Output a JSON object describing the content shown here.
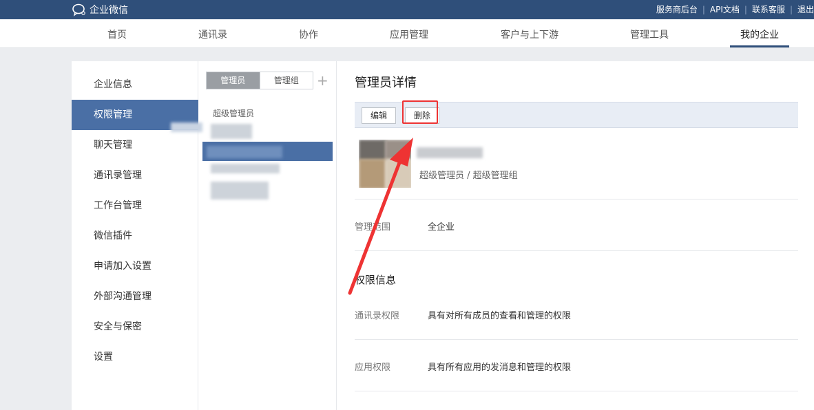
{
  "header": {
    "app_name": "企业微信",
    "links": [
      "服务商后台",
      "API文档",
      "联系客服",
      "退出"
    ]
  },
  "nav": {
    "items": [
      "首页",
      "通讯录",
      "协作",
      "应用管理",
      "客户与上下游",
      "管理工具",
      "我的企业"
    ],
    "active_index": 6
  },
  "sidebar": {
    "items": [
      "企业信息",
      "权限管理",
      "聊天管理",
      "通讯录管理",
      "工作台管理",
      "微信插件",
      "申请加入设置",
      "外部沟通管理",
      "安全与保密",
      "设置"
    ],
    "active_index": 1
  },
  "middle": {
    "tabs": [
      "管理员",
      "管理组"
    ],
    "add_icon": "plus-icon",
    "group_label": "超级管理员"
  },
  "detail": {
    "title": "管理员详情",
    "edit_label": "编辑",
    "delete_label": "删除",
    "role": "超级管理员 / 超级管理组",
    "scope_label": "管理范围",
    "scope_value": "全企业",
    "permission_title": "权限信息",
    "contacts_perm_label": "通讯录权限",
    "contacts_perm_value": "具有对所有成员的查看和管理的权限",
    "app_perm_label": "应用权限",
    "app_perm_value": "具有所有应用的发消息和管理的权限"
  },
  "colors": {
    "topbar": "#2f4f7a",
    "active": "#4a6fa5",
    "annotation": "#e33333"
  }
}
